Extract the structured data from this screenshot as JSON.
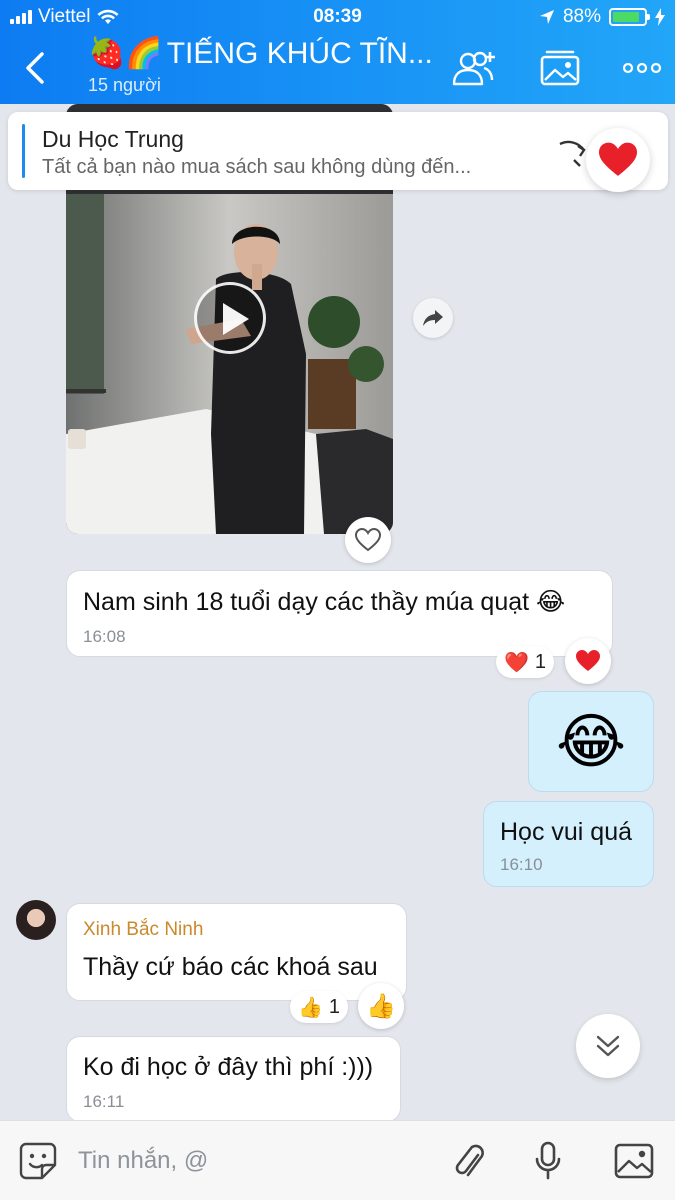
{
  "status_bar": {
    "carrier": "Viettel",
    "time": "08:39",
    "battery": "88%"
  },
  "header": {
    "emoji": "🍓🌈",
    "title": "TIẾNG KHÚC TĨN...",
    "members": "15 người"
  },
  "pinned": {
    "title": "Du Học Trung",
    "text": "Tất cả bạn nào mua sách sau không dùng đến..."
  },
  "messages": [
    {
      "text": "Nam sinh 18 tuổi dạy các thầy múa quạt 😂",
      "time": "16:08",
      "reaction": "❤️",
      "reaction_count": "1"
    },
    {
      "sticker": "😂"
    },
    {
      "text": "Học vui quá",
      "time": "16:10"
    },
    {
      "sender": "Xinh Bắc Ninh",
      "text": "Thầy cứ báo các khoá sau",
      "reaction": "👍",
      "reaction_count": "1"
    },
    {
      "text": "Ko đi học ở đây thì phí :)))",
      "time": "16:11"
    }
  ],
  "composer": {
    "placeholder": "Tin nhắn, @"
  },
  "colors": {
    "header": "#1a8cf0",
    "my_bubble": "#d4f0fd",
    "sender_name": "#c9892c"
  }
}
